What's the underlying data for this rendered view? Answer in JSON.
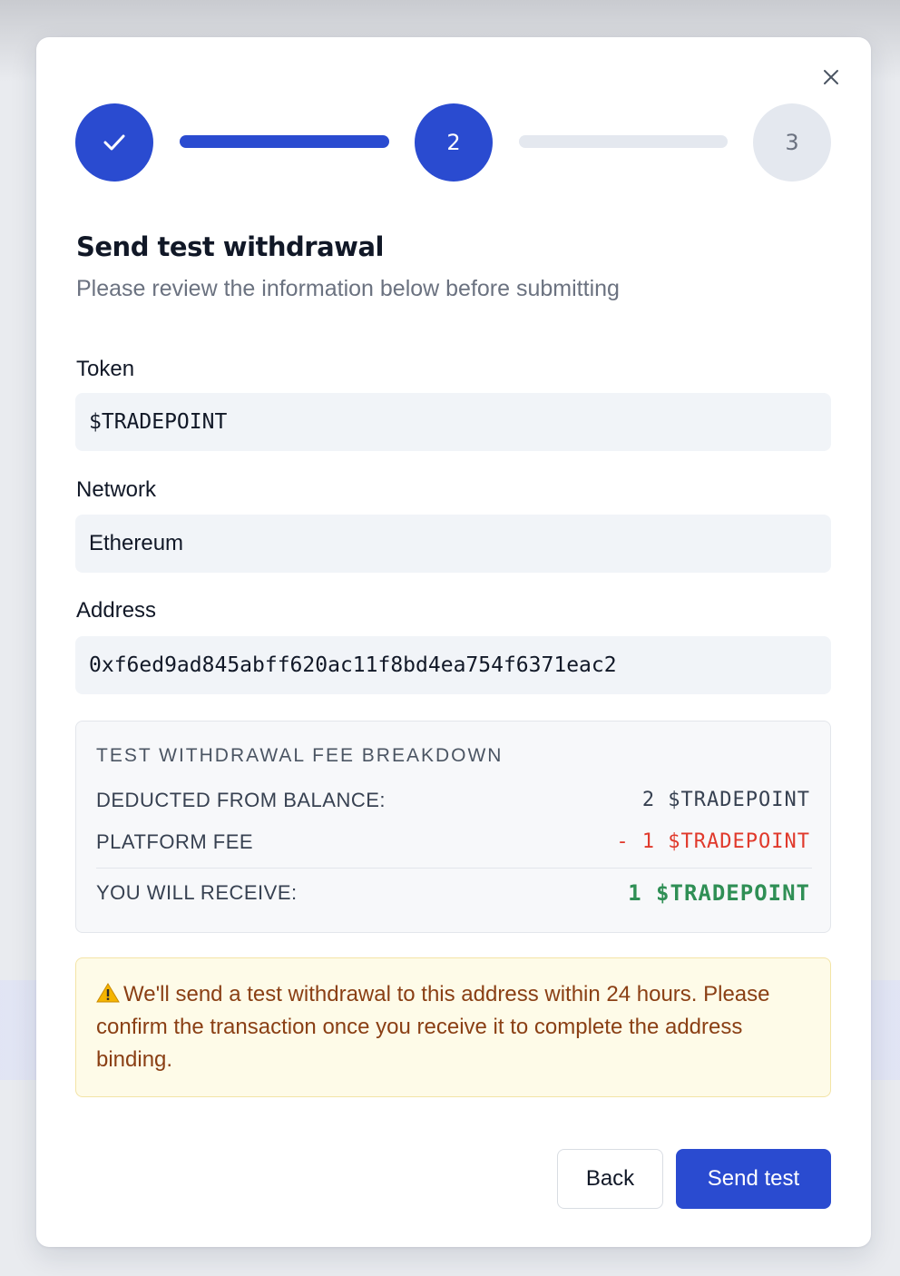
{
  "stepper": {
    "steps": [
      {
        "label": "",
        "state": "completed"
      },
      {
        "label": "2",
        "state": "active"
      },
      {
        "label": "3",
        "state": "upcoming"
      }
    ],
    "accent_color": "#2a4bd0",
    "inactive_color": "#e4e8ef"
  },
  "header": {
    "title": "Send test withdrawal",
    "subtitle": "Please review the information below before submitting"
  },
  "fields": {
    "token": {
      "label": "Token",
      "value": "$TRADEPOINT"
    },
    "network": {
      "label": "Network",
      "value": "Ethereum"
    },
    "address": {
      "label": "Address",
      "value": "0xf6ed9ad845abff620ac11f8bd4ea754f6371eac2"
    }
  },
  "fee_breakdown": {
    "heading": "TEST WITHDRAWAL FEE BREAKDOWN",
    "rows": [
      {
        "label": "DEDUCTED FROM BALANCE:",
        "value": "2 $TRADEPOINT"
      },
      {
        "label": "PLATFORM FEE",
        "value": "- 1 $TRADEPOINT"
      },
      {
        "label": "YOU WILL RECEIVE:",
        "value": "1 $TRADEPOINT"
      }
    ],
    "colors": {
      "fee": "#e0392b",
      "receive": "#2f8f55"
    }
  },
  "notice": {
    "icon": "warning-icon",
    "text": "We'll send a test withdrawal to this address within 24 hours. Please confirm the transaction once you receive it to complete the address binding."
  },
  "actions": {
    "back_label": "Back",
    "send_label": "Send test"
  }
}
